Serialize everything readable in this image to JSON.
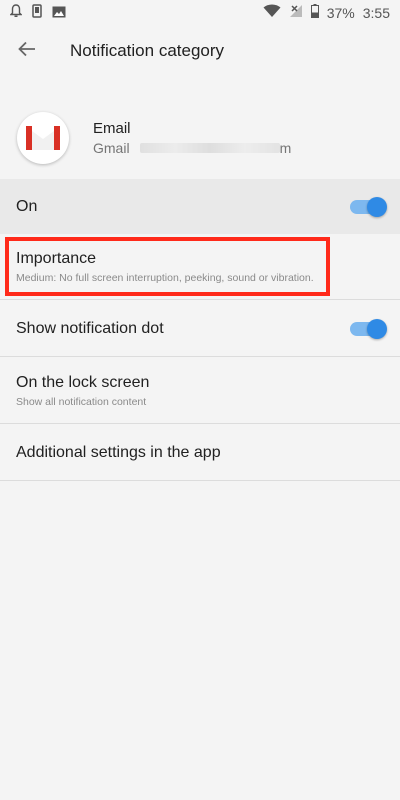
{
  "status_bar": {
    "battery": "37%",
    "time": "3:55",
    "icons_left": [
      "notification-bell-icon",
      "phone-icon",
      "image-icon"
    ],
    "icons_right": [
      "wifi-icon",
      "no-signal-icon",
      "battery-icon"
    ]
  },
  "app_bar": {
    "title": "Notification category"
  },
  "app": {
    "name": "Email",
    "account": "Gmail",
    "account_suffix": "m"
  },
  "settings": {
    "on": {
      "label": "On",
      "enabled": true
    },
    "importance": {
      "label": "Importance",
      "summary": "Medium: No full screen interruption, peeking, sound or vibration."
    },
    "notification_dot": {
      "label": "Show notification dot",
      "enabled": true
    },
    "lock_screen": {
      "label": "On the lock screen",
      "summary": "Show all notification content"
    },
    "additional": {
      "label": "Additional settings in the app"
    }
  },
  "colors": {
    "accent": "#2f8ae5",
    "highlight": "#ff2a1a"
  }
}
